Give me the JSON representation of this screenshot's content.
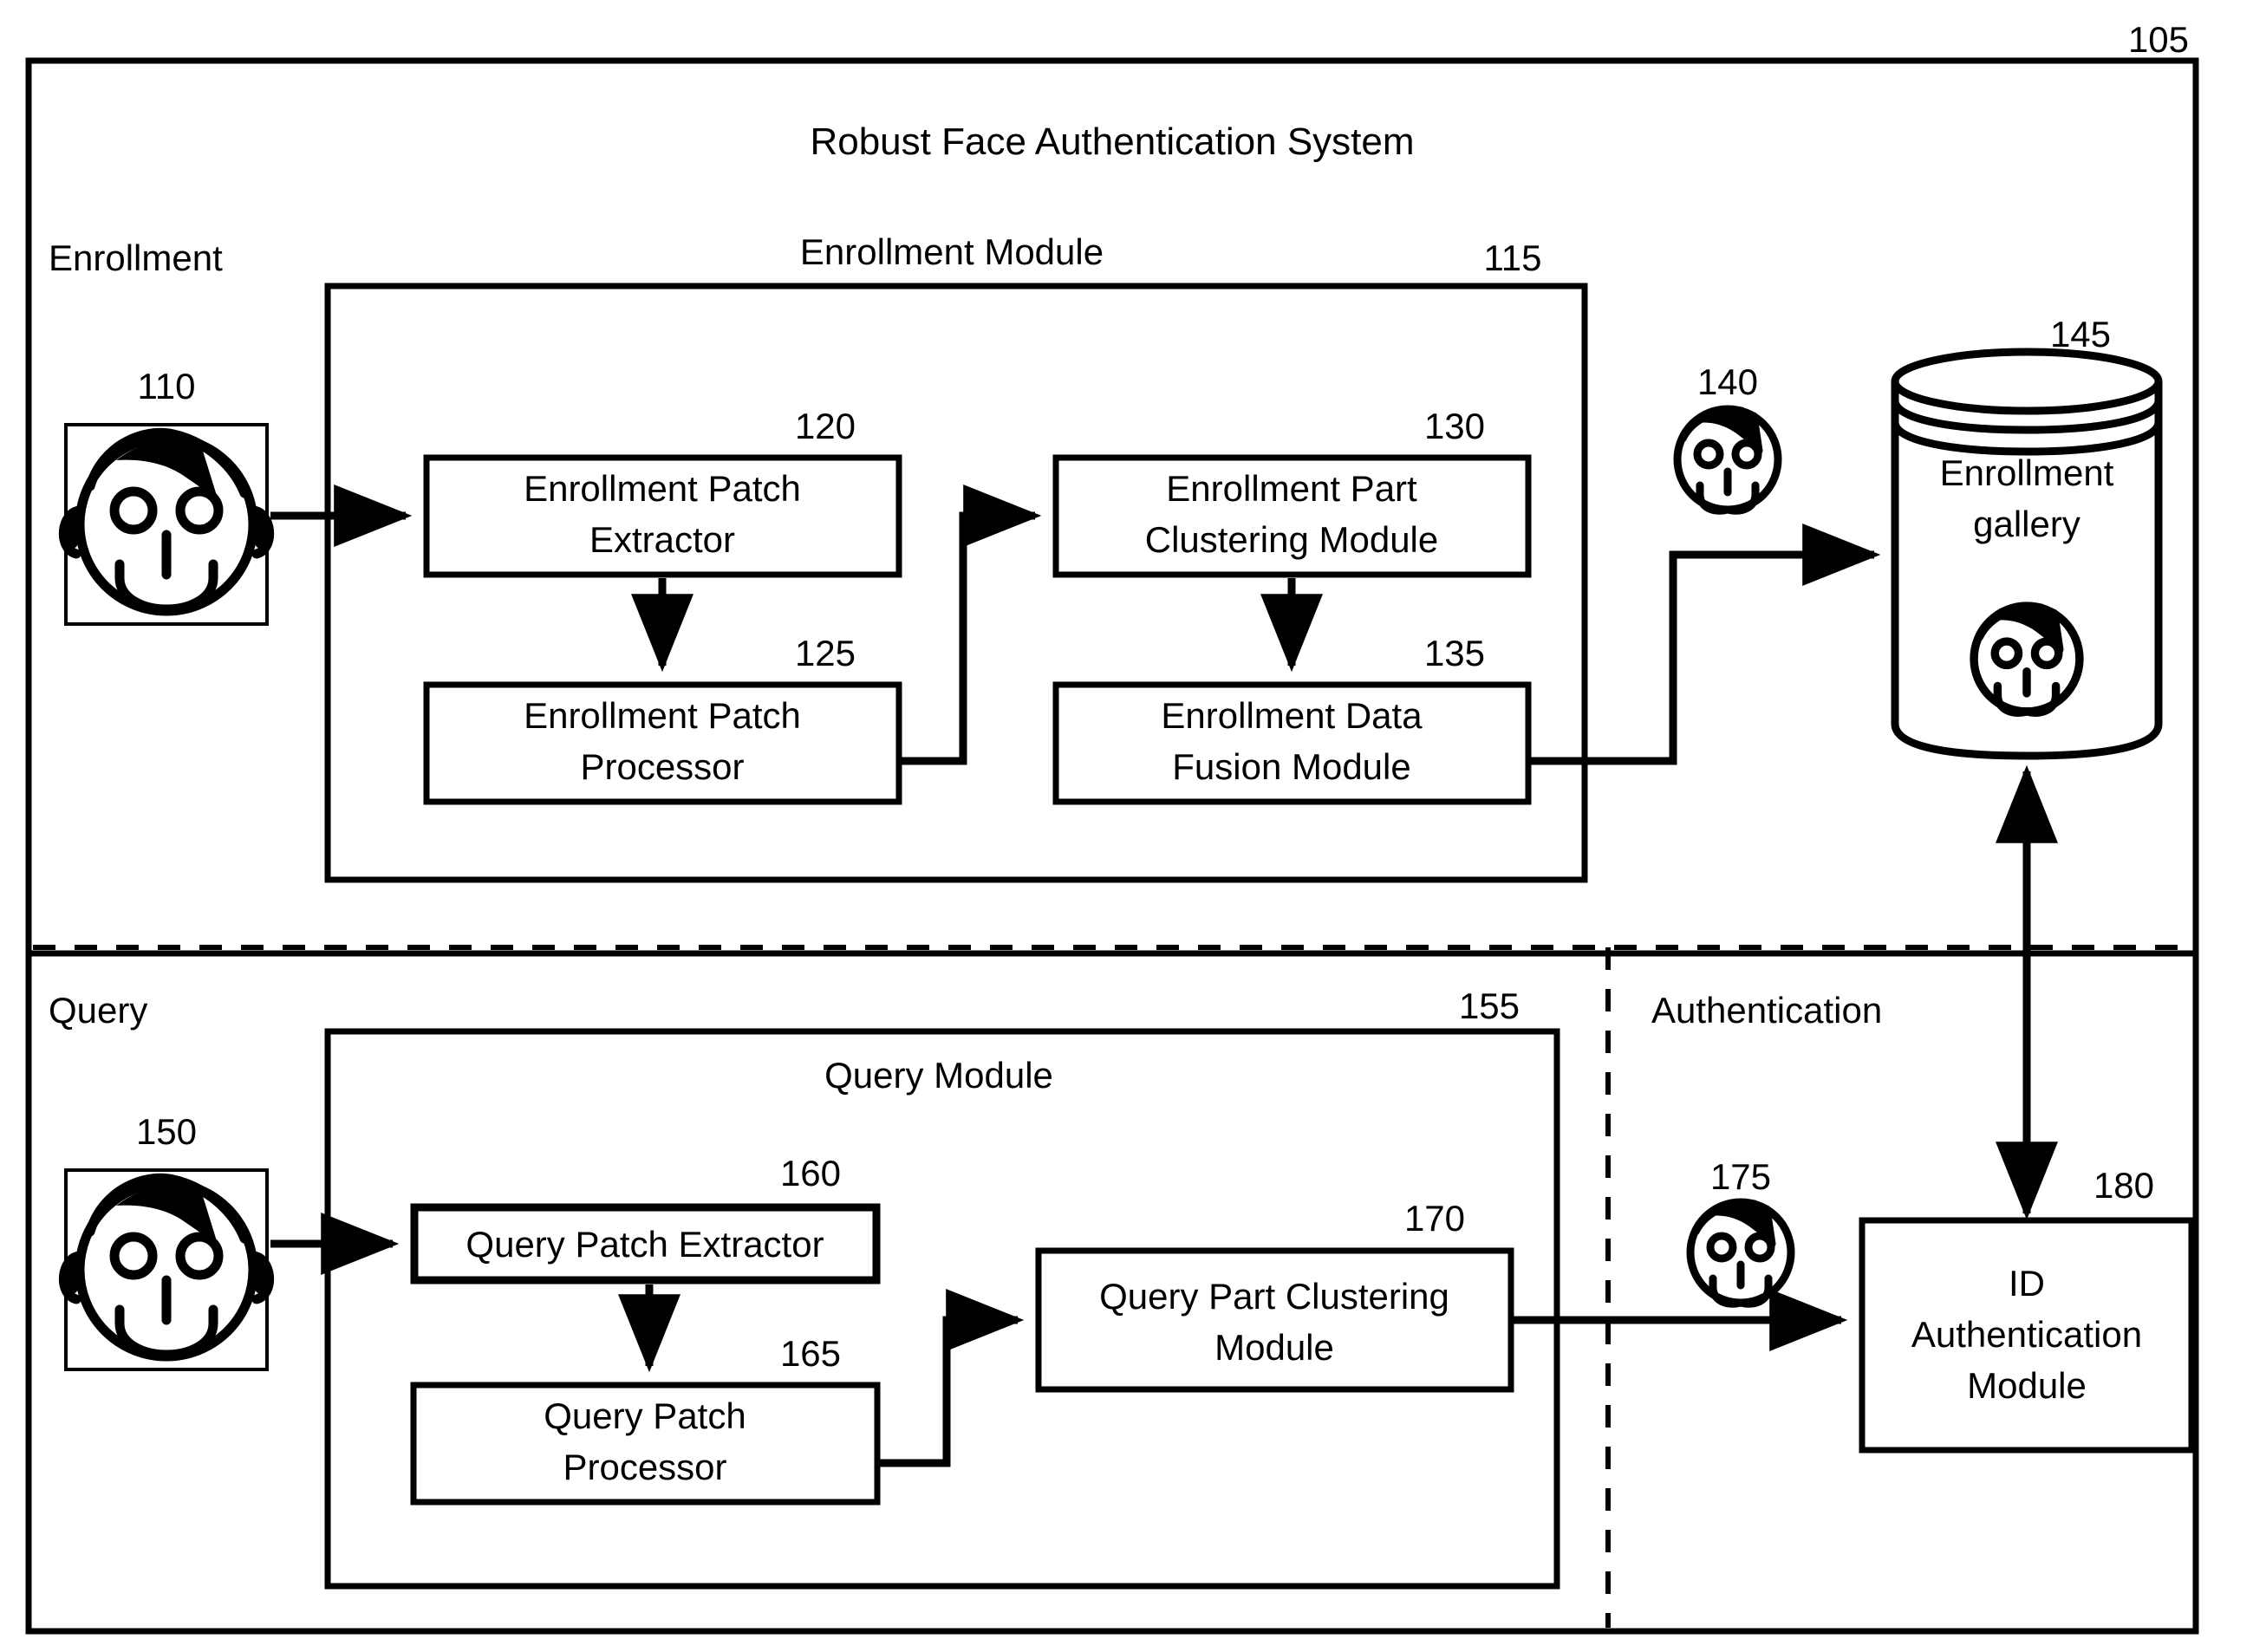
{
  "figure": {
    "system_ref": "105",
    "system_title": "Robust Face Authentication System"
  },
  "enrollment_section": {
    "label": "Enrollment",
    "input_image_ref": "110",
    "module": {
      "ref": "115",
      "title": "Enrollment Module",
      "blocks": [
        {
          "ref": "120",
          "label_line1": "Enrollment Patch",
          "label_line2": "Extractor"
        },
        {
          "ref": "125",
          "label_line1": "Enrollment Patch",
          "label_line2": "Processor"
        },
        {
          "ref": "130",
          "label_line1": "Enrollment Part",
          "label_line2": "Clustering Module"
        },
        {
          "ref": "135",
          "label_line1": "Enrollment Data",
          "label_line2": "Fusion Module"
        }
      ]
    },
    "output_face_ref": "140",
    "gallery": {
      "ref": "145",
      "label_line1": "Enrollment",
      "label_line2": "gallery"
    }
  },
  "query_section": {
    "label": "Query",
    "input_image_ref": "150",
    "module": {
      "ref": "155",
      "title": "Query Module",
      "blocks": [
        {
          "ref": "160",
          "label_line1": "Query Patch Extractor",
          "label_line2": ""
        },
        {
          "ref": "165",
          "label_line1": "Query Patch",
          "label_line2": "Processor"
        },
        {
          "ref": "170",
          "label_line1": "Query Part Clustering",
          "label_line2": "Module"
        }
      ]
    },
    "output_face_ref": "175"
  },
  "authentication_section": {
    "label": "Authentication",
    "face_ref": "175",
    "module": {
      "ref": "180",
      "label_line1": "ID",
      "label_line2": "Authentication",
      "label_line3": "Module"
    }
  },
  "style": {
    "line_color": "#000000",
    "background": "#ffffff"
  }
}
